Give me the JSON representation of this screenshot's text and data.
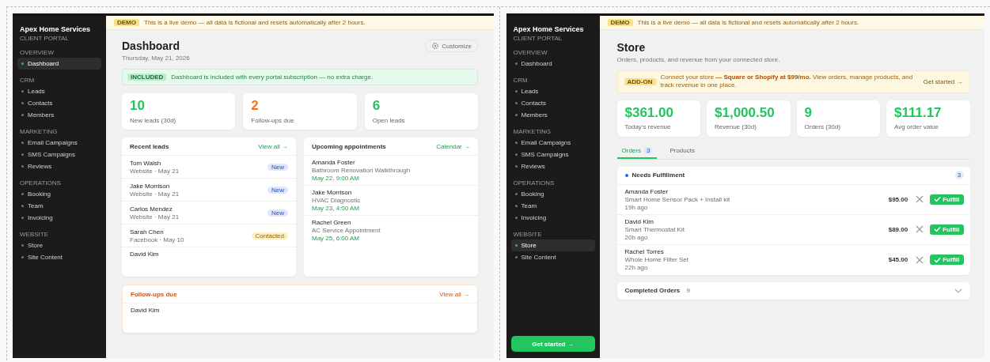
{
  "dashboard_screenshot": {
    "sidebar": {
      "brand": "Apex Home Services",
      "subtitle": "CLIENT PORTAL",
      "sections": [
        {
          "label": "OVERVIEW",
          "items": [
            {
              "label": "Dashboard",
              "selected": true
            }
          ]
        },
        {
          "label": "CRM",
          "items": [
            {
              "label": "Leads",
              "selected": false
            },
            {
              "label": "Contacts",
              "selected": false
            },
            {
              "label": "Members",
              "selected": false
            }
          ]
        },
        {
          "label": "MARKETING",
          "items": [
            {
              "label": "Email Campaigns",
              "selected": false
            },
            {
              "label": "SMS Campaigns",
              "selected": false
            },
            {
              "label": "Reviews",
              "selected": false
            }
          ]
        },
        {
          "label": "OPERATIONS",
          "items": [
            {
              "label": "Booking",
              "selected": false
            },
            {
              "label": "Team",
              "selected": false
            },
            {
              "label": "Invoicing",
              "selected": false
            }
          ]
        },
        {
          "label": "WEBSITE",
          "items": [
            {
              "label": "Store",
              "selected": false
            },
            {
              "label": "Site Content",
              "selected": false
            }
          ]
        }
      ]
    },
    "demo_banner": {
      "badge": "DEMO",
      "text": "This is a live demo — all data is fictional and resets automatically after 2 hours."
    },
    "title": "Dashboard",
    "date": "Thursday, May 21, 2026",
    "customize": "Customize",
    "included": {
      "badge": "INCLUDED",
      "text": "Dashboard is included with every portal subscription — no extra charge."
    },
    "stats": [
      {
        "value": "10",
        "label": "New leads (30d)",
        "color": "#22c55e"
      },
      {
        "value": "2",
        "label": "Follow-ups due",
        "color": "#f97316"
      },
      {
        "value": "6",
        "label": "Open leads",
        "color": "#22c55e"
      }
    ],
    "recent_leads": {
      "title": "Recent leads",
      "link": "View all →",
      "rows": [
        {
          "name": "Tom Walsh",
          "meta": "Website · May 21",
          "status": "New",
          "kind": "new"
        },
        {
          "name": "Jake Morrison",
          "meta": "Website · May 21",
          "status": "New",
          "kind": "new"
        },
        {
          "name": "Carlos Mendez",
          "meta": "Website · May 21",
          "status": "New",
          "kind": "new"
        },
        {
          "name": "Sarah Chen",
          "meta": "Facebook · May 10",
          "status": "Contacted",
          "kind": "contacted"
        },
        {
          "name": "David Kim"
        }
      ]
    },
    "appointments": {
      "title": "Upcoming appointments",
      "link": "Calendar →",
      "rows": [
        {
          "name": "Amanda Foster",
          "service": "Bathroom Renovation Walkthrough",
          "time": "May 22, 9:00 AM"
        },
        {
          "name": "Jake Morrison",
          "service": "HVAC Diagnostic",
          "time": "May 23, 4:00 AM"
        },
        {
          "name": "Rachel Green",
          "service": "AC Service Appointment",
          "time": "May 25, 6:00 AM"
        }
      ]
    },
    "followups": {
      "title": "Follow-ups due",
      "link": "View all →",
      "rows": [
        {
          "name": "David Kim"
        }
      ]
    }
  },
  "store_screenshot": {
    "sidebar": {
      "brand": "Apex Home Services",
      "subtitle": "CLIENT PORTAL",
      "sections": [
        {
          "label": "OVERVIEW",
          "items": [
            {
              "label": "Dashboard",
              "selected": false
            }
          ]
        },
        {
          "label": "CRM",
          "items": [
            {
              "label": "Leads",
              "selected": false
            },
            {
              "label": "Contacts",
              "selected": false
            },
            {
              "label": "Members",
              "selected": false
            }
          ]
        },
        {
          "label": "MARKETING",
          "items": [
            {
              "label": "Email Campaigns",
              "selected": false
            },
            {
              "label": "SMS Campaigns",
              "selected": false
            },
            {
              "label": "Reviews",
              "selected": false
            }
          ]
        },
        {
          "label": "OPERATIONS",
          "items": [
            {
              "label": "Booking",
              "selected": false
            },
            {
              "label": "Team",
              "selected": false
            },
            {
              "label": "Invoicing",
              "selected": false
            }
          ]
        },
        {
          "label": "WEBSITE",
          "items": [
            {
              "label": "Store",
              "selected": true
            },
            {
              "label": "Site Content",
              "selected": false
            }
          ]
        }
      ],
      "cta": "Get started →"
    },
    "demo_banner": {
      "badge": "DEMO",
      "text": "This is a live demo — all data is fictional and resets automatically after 2 hours."
    },
    "title": "Store",
    "subtitle": "Orders, products, and revenue from your connected store.",
    "addon": {
      "badge": "ADD-ON",
      "text": "Connect your store **— Square or Shopify at $99/mo.** View orders, manage products, and track revenue in one place.",
      "link": "Get started →"
    },
    "stats": [
      {
        "value": "$361.00",
        "label": "Today's revenue"
      },
      {
        "value": "$1,000.50",
        "label": "Revenue (30d)"
      },
      {
        "value": "9",
        "label": "Orders (30d)"
      },
      {
        "value": "$111.17",
        "label": "Avg order value"
      }
    ],
    "tabs": [
      {
        "label": "Orders",
        "count": "3",
        "selected": true
      },
      {
        "label": "Products",
        "selected": false
      }
    ],
    "needs_fulfillment": {
      "title": "Needs Fulfillment",
      "count": "3",
      "rows": [
        {
          "name": "Amanda Foster",
          "product": "Smart Home Sensor Pack + Install kit",
          "age": "19h ago",
          "price": "$95.00",
          "button": "Fulfill"
        },
        {
          "name": "David Kim",
          "product": "Smart Thermostat Kit",
          "age": "20h ago",
          "price": "$89.00",
          "button": "Fulfill"
        },
        {
          "name": "Rachel Torres",
          "product": "Whole Home Filter Set",
          "age": "22h ago",
          "price": "$45.00",
          "button": "Fulfill"
        }
      ]
    },
    "completed": {
      "title": "Completed Orders",
      "count": "9"
    }
  }
}
